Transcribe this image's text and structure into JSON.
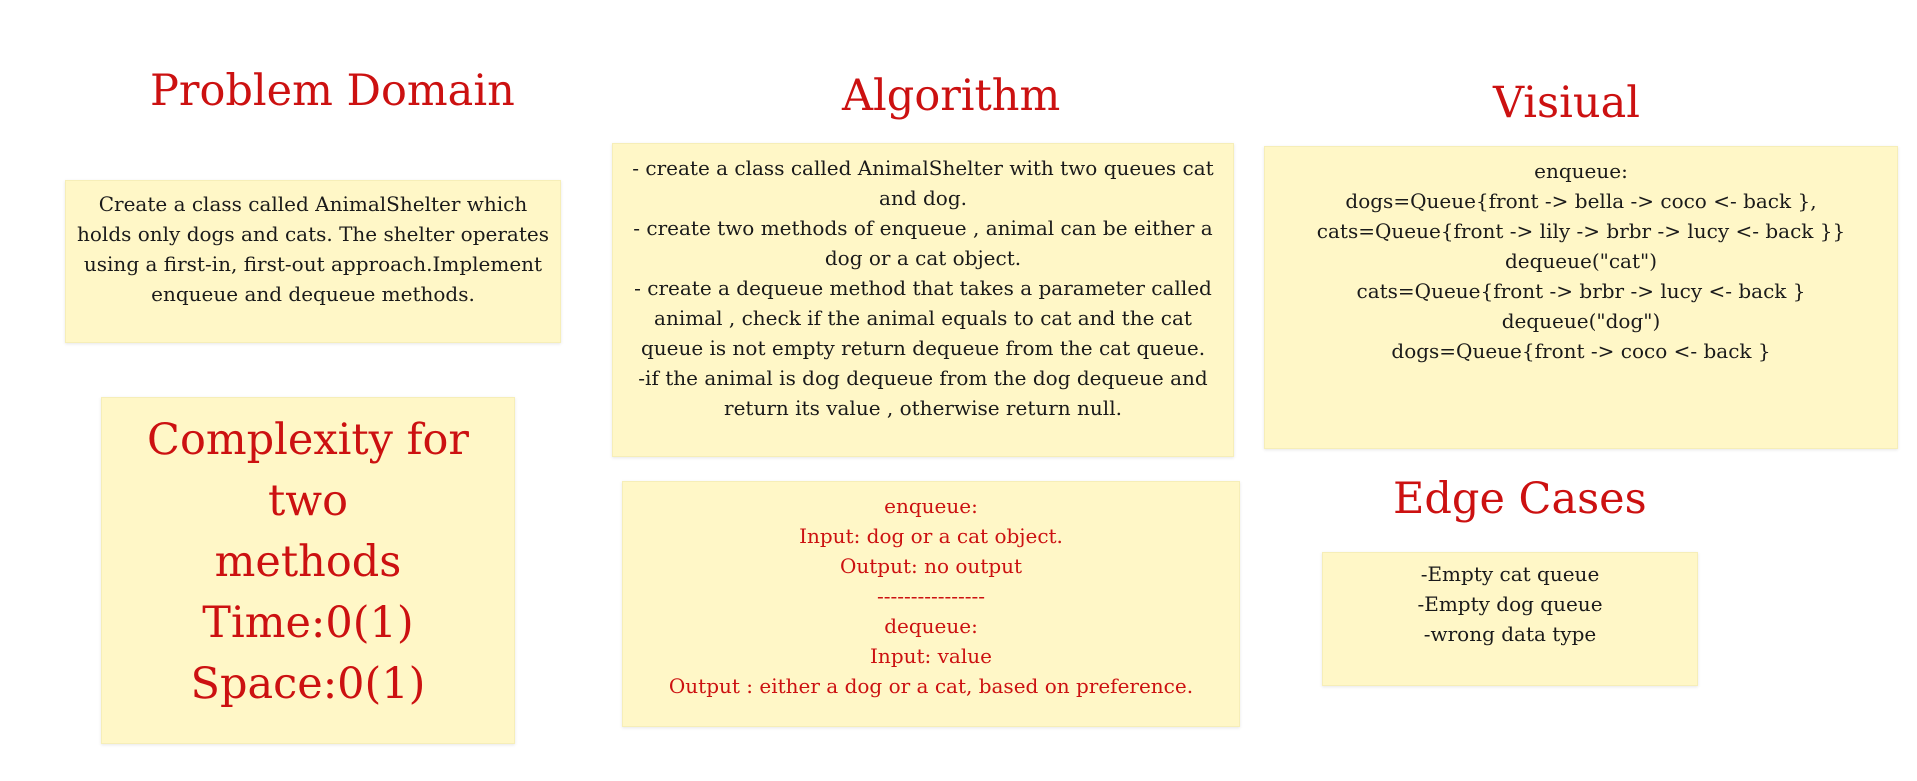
{
  "titles": {
    "problem_domain": "Problem Domain",
    "algorithm": "Algorithm",
    "visual": "Visiual",
    "edge_cases": "Edge Cases"
  },
  "problem_domain_text": "Create a class called AnimalShelter which holds only dogs and cats. The shelter operates using a first-in, first-out approach.Implement enqueue and dequeue methods.",
  "complexity": {
    "lines": [
      "Complexity for two",
      "methods",
      "Time:0(1)",
      "Space:0(1)"
    ]
  },
  "algorithm_steps": [
    "- create a class called AnimalShelter with two queues cat and dog.",
    "- create two methods of enqueue , animal can be either a dog or a cat object.",
    "- create a dequeue method that takes a parameter called animal , check if the animal equals to cat and the cat queue is not empty return dequeue from the cat queue.",
    "-if the animal is dog dequeue from the dog dequeue and return its value , otherwise return null."
  ],
  "io_spec": [
    "enqueue:",
    "Input: dog or a cat object.",
    "Output: no output",
    "----------------",
    "dequeue:",
    "Input: value",
    "Output : either a dog or a cat, based on preference."
  ],
  "visual_lines": [
    "enqueue:",
    "dogs=Queue{front -> bella -> coco <- back },",
    "cats=Queue{front -> lily -> brbr -> lucy <- back }}",
    "dequeue(\"cat\")",
    "cats=Queue{front -> brbr -> lucy <- back }",
    "dequeue(\"dog\")",
    "dogs=Queue{front -> coco <- back }"
  ],
  "edge_cases": [
    "-Empty cat queue",
    "-Empty dog queue",
    "-wrong data type"
  ],
  "colors": {
    "title": "#cc1111",
    "note_background": "#fff7c7",
    "body_text": "#1a1a1a"
  }
}
